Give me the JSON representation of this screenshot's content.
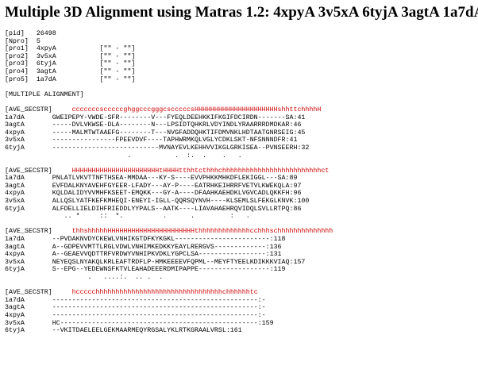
{
  "page": {
    "title": "Multiple 3D Alignment using Matras 1.2: 4xpyA 3v5xA 6tyjA 3agtA 1a7dA"
  },
  "text_lines": [
    {
      "t": "[pid]   26498"
    },
    {
      "t": "[Npro]  5"
    },
    {
      "t": "[pro1]  4xpyA           [\"\" - \"\"]"
    },
    {
      "t": "[pro2]  3v5xA           [\"\" - \"\"]"
    },
    {
      "t": "[pro3]  6tyjA           [\"\" - \"\"]"
    },
    {
      "t": "[pro4]  3agtA           [\"\" - \"\"]"
    },
    {
      "t": "[pro5]  1a7dA           [\"\" - \"\"]"
    },
    {
      "t": ""
    },
    {
      "t": "[MULTIPLE ALIGNMENT]"
    },
    {
      "t": ""
    },
    {
      "t": "[AVE_SECSTR]",
      "r": "cccccccscccccghggcccgggcscccccsHHHHHHHHHHHHHHHHHHHHHshhttchhhhH"
    },
    {
      "t": "1a7dA       GWEIPEPY-VWDE-SFR--------V---FYEQLDEEHKKIFKGIFDCIRDN-------SA:41"
    },
    {
      "t": "3agtA       -----DVLVKWSE-DLA--------N---LPSIDTQHKRLVDYINDLYRAARRRDMDKAR:46"
    },
    {
      "t": "4xpyA       -----MALMTWTAAEFG--------T---NVGFADDQHKTIFDMVNKLHDTAATGNRSEIG:45"
    },
    {
      "t": "3v5xA       ----------------FPEEVDVF----TAPHWRMKQLVGLYCDKLSKT-NFSNNNDFR:41"
    },
    {
      "t": "6tyjA       ---------------------------MVNAYEVLKEHHVVIKGLGRKISEA--PVNSEERH:32"
    },
    {
      "t": "                               .           .  :.  .    .   ."
    },
    {
      "t": ""
    },
    {
      "t": "[AVE_SECSTR]",
      "r": "HHHHHHHHHHHHHHHHHHHHHHtHHHHtthhtcthhhchhhhhhhhhhhhhhhhhhhhhhhhhct"
    },
    {
      "t": "1a7dA       PNLATLVKVTTNFTHSEA-MMDAA---KY-S----EVVPHKKMHKDFLEKIGGL---SA:89"
    },
    {
      "t": "3agtA       EVFDALKNYAVEHFGYEER-LFADY---AY-P----EATRHKEIHRRFVETVLKWEKQLA:97"
    },
    {
      "t": "4xpyA       KQLDALIDYVVMHFKSEET-EMQKK---GY-A----DFAAHKAEHDKLVGVCADLQKKFH:96"
    },
    {
      "t": "3v5xA       ALLQSLYATFKEFKMHEQI-ENEYI-IGLL-QQRSQYNVH----KLSEMLSLFEKGLKNVK:100"
    },
    {
      "t": "6tyjA       ALFDELLIELDIHFRIEDDLYYPALS--AATK----LIAVAHAEHRQVIDQLSVLLRTPQ:86"
    },
    {
      "t": "               .. *     ::  *.          .      .         :   ."
    },
    {
      "t": ""
    },
    {
      "t": "[AVE_SECSTR]",
      "r": "thhshhhhhHHHHHHHHHHHHHHHHHHHHHHthhhhhhhhhhhhhcchhhschhhhhhhhhhhhhh"
    },
    {
      "t": "1a7dA       --PVDAKNVDYCKEWLVNHIKGTDFKYKGKL------------------------:118"
    },
    {
      "t": "3agtA       A--GDPEVVMTTLRGLVDWLVNHIMKEDKKYEAYLRERGVS-------------:136"
    },
    {
      "t": "4xpyA       A--GEAEVVQDTTRFVRDWYVNHIPKVDKLYGPCLSA-----------------:131"
    },
    {
      "t": "3v5xA       NEYEQSLNYAKQLKRLEAFTRDFLP-HMKEEEEVFQPML--MEYFTYEELKDIKKKVIAQ:157"
    },
    {
      "t": "6tyjA       S--EPG--YEDEWNSFKTVLEAHADEEERDMIPAPPE------------------:119"
    },
    {
      "t": "                     .   ....:.  .. .  ."
    },
    {
      "t": ""
    },
    {
      "t": "[AVE_SECSTR]",
      "r": "hccccchhhhhhhhhhhhhhhhhhhhhhhhhhhhhhhhchhhhhhtc"
    },
    {
      "t": "1a7dA       ----------------------------------------------------:-"
    },
    {
      "t": "3agtA       ----------------------------------------------------:-"
    },
    {
      "t": "4xpyA       ----------------------------------------------------:-"
    },
    {
      "t": "3v5xA       HC--------------------------------------------------:159"
    },
    {
      "t": "6tyjA       --VKITDAELEELGEKMAARMEQYRGSALYKLRTKGRAALVRSL:161"
    }
  ]
}
